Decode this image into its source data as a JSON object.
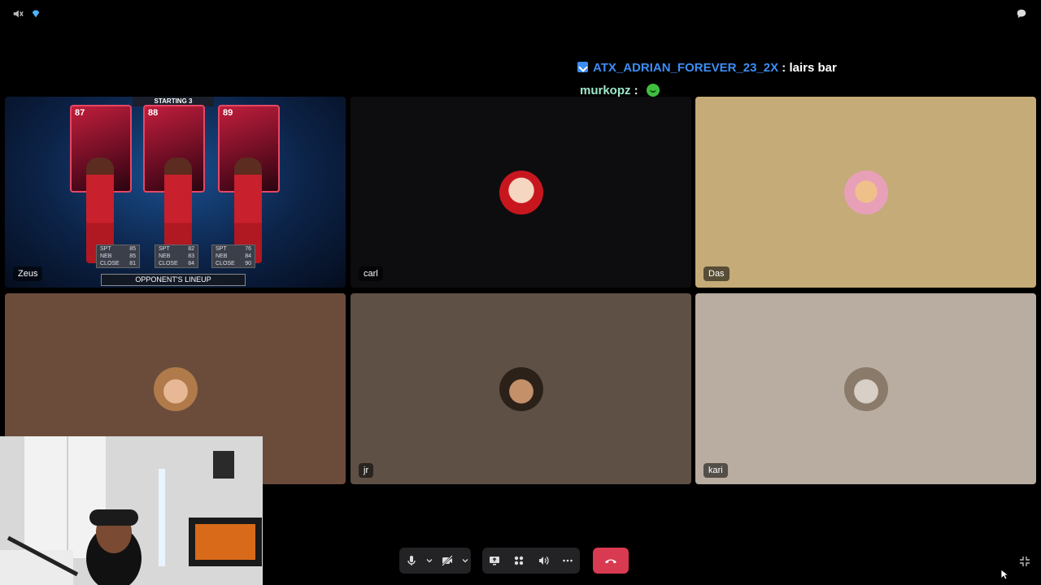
{
  "top_bar": {
    "left_icons": [
      "speaker-mute-icon",
      "nitro-gem-icon"
    ],
    "right_icon": "chat-bubble-icon"
  },
  "chat": [
    {
      "user": "ATX_ADRIAN_FOREVER_23_2X",
      "separator": " : ",
      "message": "lairs bar",
      "badge": "subscriber-badge-icon"
    },
    {
      "user": "murkopz",
      "separator": " : ",
      "message": "",
      "emote": "green-emote-icon"
    }
  ],
  "tiles": [
    {
      "name": "Zeus",
      "bg": "#0c2348"
    },
    {
      "name": "carl",
      "bg": "#0d0d10"
    },
    {
      "name": "Das",
      "bg": "#c4ab78"
    },
    {
      "name": "",
      "bg": "#6b4c3b"
    },
    {
      "name": "jr",
      "bg": "#5e5045"
    },
    {
      "name": "kari",
      "bg": "#b9ada1"
    }
  ],
  "game": {
    "banner": "STARTING 3",
    "footer": "OPPONENT'S LINEUP",
    "cards": [
      {
        "rating": "87",
        "stats": [
          [
            "SPT",
            "85"
          ],
          [
            "NEB",
            "85"
          ],
          [
            "CLOSE",
            "81"
          ]
        ]
      },
      {
        "rating": "88",
        "stats": [
          [
            "SPT",
            "82"
          ],
          [
            "NEB",
            "83"
          ],
          [
            "CLOSE",
            "84"
          ]
        ]
      },
      {
        "rating": "89",
        "stats": [
          [
            "SPT",
            "76"
          ],
          [
            "NEB",
            "84"
          ],
          [
            "CLOSE",
            "90"
          ]
        ]
      }
    ]
  },
  "controls": {
    "mic_icon": "microphone-icon",
    "camera_icon": "camera-off-icon",
    "screenshare_icon": "screen-share-icon",
    "activities_icon": "activities-icon",
    "soundboard_icon": "soundboard-icon",
    "more_icon": "more-dots-icon",
    "hangup_icon": "hang-up-icon"
  },
  "colors": {
    "accent_blue": "#3d8df5",
    "hangup_red": "#d83a52",
    "control_bg": "#232325"
  }
}
